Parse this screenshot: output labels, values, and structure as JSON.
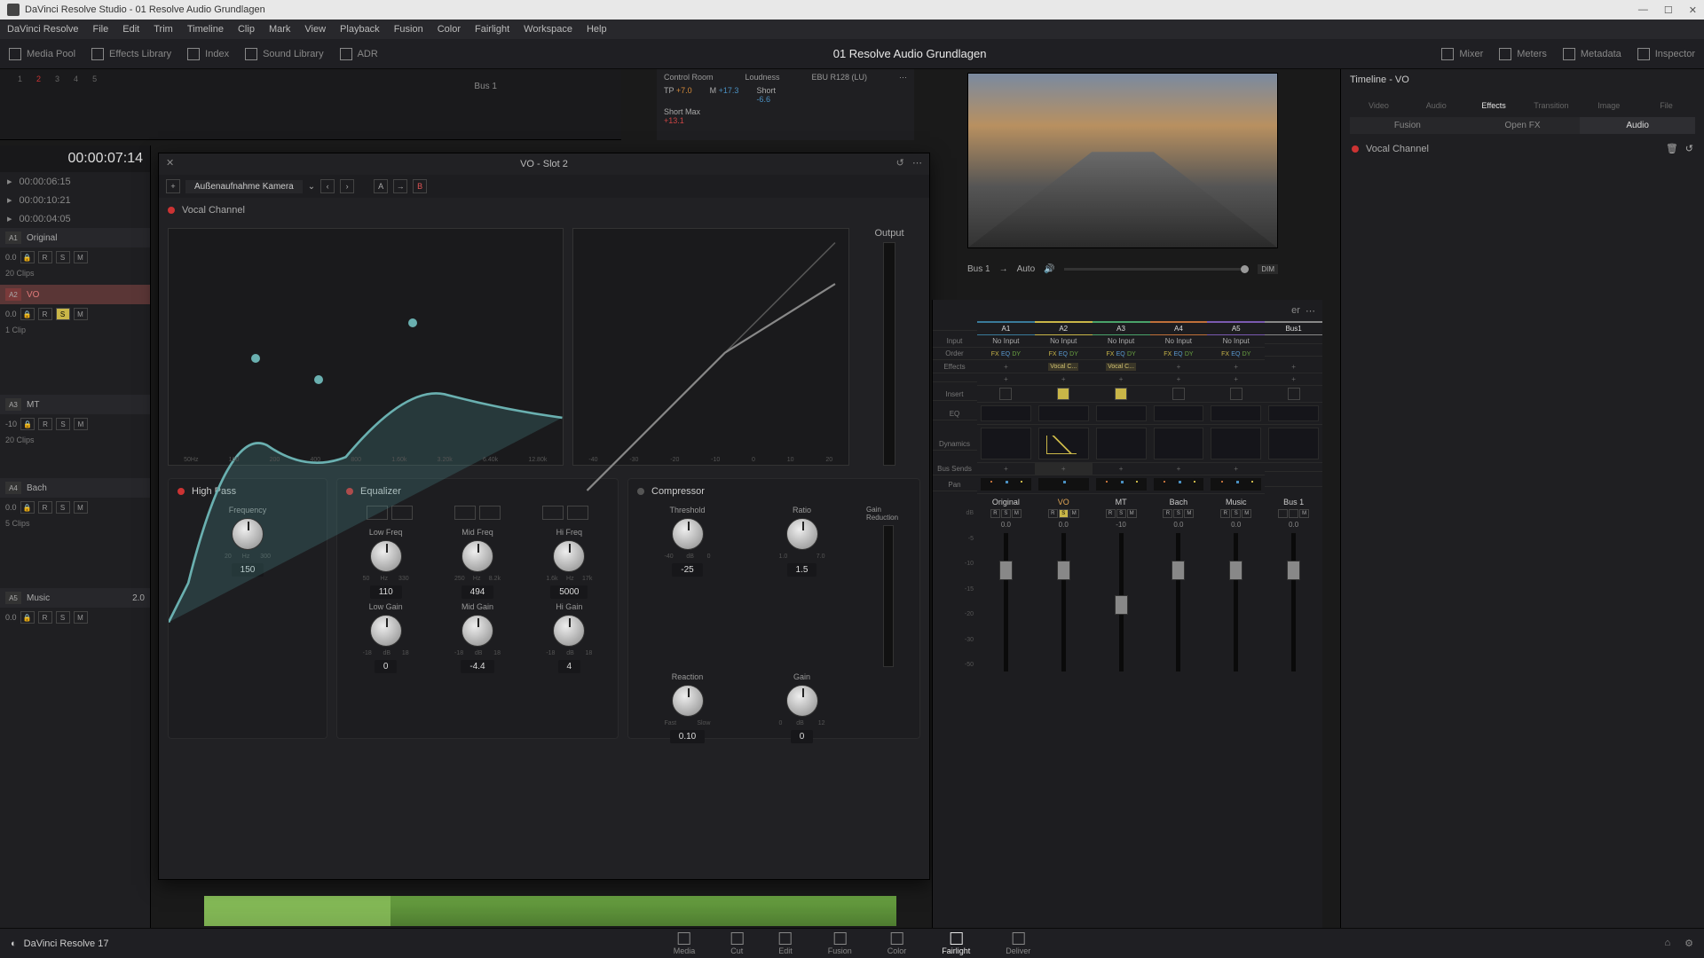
{
  "window_title": "DaVinci Resolve Studio - 01 Resolve Audio Grundlagen",
  "menubar": [
    "DaVinci Resolve",
    "File",
    "Edit",
    "Trim",
    "Timeline",
    "Clip",
    "Mark",
    "View",
    "Playback",
    "Fusion",
    "Color",
    "Fairlight",
    "Workspace",
    "Help"
  ],
  "toolbar": {
    "left": [
      "Media Pool",
      "Effects Library",
      "Index",
      "Sound Library",
      "ADR"
    ],
    "project": "01 Resolve Audio Grundlagen",
    "right": [
      "Mixer",
      "Meters",
      "Metadata",
      "Inspector"
    ]
  },
  "meters_nums": [
    "1",
    "2",
    "3",
    "4",
    "5"
  ],
  "bus_label": "Bus 1",
  "control_room": "Control Room",
  "loudness": {
    "title": "Loudness",
    "std": "EBU R128 (LU)",
    "tp_label": "TP",
    "tp_val": "+7.0",
    "m_label": "M",
    "m_val": "+17.3",
    "short_label": "Short",
    "short_val": "-6.6",
    "shortmax_label": "Short Max",
    "shortmax_val": "+13.1"
  },
  "transport": {
    "timecode": "00:00:07:14",
    "in": "00:00:06:15",
    "out": "00:00:10:21",
    "dur": "00:00:04:05"
  },
  "tracks": [
    {
      "id": "A1",
      "name": "Original",
      "vol": "0.0",
      "clips": "20 Clips"
    },
    {
      "id": "A2",
      "name": "VO",
      "vol": "0.0",
      "clips": "1 Clip",
      "sel": true,
      "solo": true
    },
    {
      "id": "A3",
      "name": "MT",
      "vol": "-10",
      "clips": "20 Clips"
    },
    {
      "id": "A4",
      "name": "Bach",
      "vol": "0.0",
      "clips": "5 Clips"
    },
    {
      "id": "A5",
      "name": "Music",
      "vol": "0.0",
      "right": "2.0"
    }
  ],
  "below_video": {
    "bus": "Bus 1",
    "auto": "Auto",
    "dim": "DIM"
  },
  "inspector": {
    "title": "Timeline - VO",
    "tabs": [
      "Video",
      "Audio",
      "Effects",
      "Transition",
      "Image",
      "File"
    ],
    "active_tab": "Effects",
    "subtabs": [
      "Fusion",
      "Open FX",
      "Audio"
    ],
    "active_sub": "Audio",
    "plugin": "Vocal Channel"
  },
  "plugin": {
    "title": "VO - Slot 2",
    "preset": "Außenaufnahme Kamera",
    "section": "Vocal Channel",
    "output": "Output",
    "eq_axis": [
      "50Hz",
      "100",
      "200",
      "400",
      "800",
      "1.60k",
      "3.20k",
      "6.40k",
      "12.80k"
    ],
    "comp_axis": [
      "-40",
      "-30",
      "-20",
      "-10",
      "0",
      "10",
      "20"
    ],
    "hp": {
      "title": "High Pass",
      "freq_label": "Frequency",
      "min": "20",
      "mid": "Hz",
      "max": "300",
      "val": "150"
    },
    "eq": {
      "title": "Equalizer",
      "cols": [
        "Low Freq",
        "Mid Freq",
        "Hi Freq"
      ],
      "freq_scales": [
        [
          "50",
          "Hz",
          "330"
        ],
        [
          "250",
          "Hz",
          "8.2k"
        ],
        [
          "1.6k",
          "Hz",
          "17k"
        ]
      ],
      "freq_vals": [
        "110",
        "494",
        "5000"
      ],
      "gain_labels": [
        "Low Gain",
        "Mid Gain",
        "Hi Gain"
      ],
      "gain_scales": [
        [
          "-18",
          "dB",
          "18"
        ],
        [
          "-18",
          "dB",
          "18"
        ],
        [
          "-18",
          "dB",
          "18"
        ]
      ],
      "gain_vals": [
        "0",
        "-4.4",
        "4"
      ]
    },
    "comp": {
      "title": "Compressor",
      "thresh_label": "Threshold",
      "thresh_scale": [
        "-40",
        "dB",
        "0"
      ],
      "thresh_val": "-25",
      "ratio_label": "Ratio",
      "ratio_scale": [
        "1.0",
        "",
        "7.0"
      ],
      "ratio_val": "1.5",
      "gr_label": "Gain Reduction",
      "react_label": "Reaction",
      "react_scale": [
        "Fast",
        "",
        "Slow"
      ],
      "react_val": "0.10",
      "gain_label": "Gain",
      "gain_scale": [
        "0",
        "dB",
        "12"
      ],
      "gain_val": "0"
    }
  },
  "mixer": {
    "title": "Mixer",
    "channels": [
      "A1",
      "A2",
      "A3",
      "A4",
      "A5",
      "Bus1"
    ],
    "row_labels": {
      "input": "Input",
      "order": "Order",
      "effects": "Effects",
      "insert": "Insert",
      "eq": "EQ",
      "dyn": "Dynamics",
      "bus": "Bus Sends",
      "pan": "Pan",
      "db": "dB"
    },
    "inputs": [
      "No Input",
      "No Input",
      "No Input",
      "No Input",
      "No Input",
      ""
    ],
    "effects": [
      "",
      "Vocal C...",
      "Vocal C...",
      "",
      "",
      ""
    ],
    "names": [
      "Original",
      "VO",
      "MT",
      "Bach",
      "Music",
      "Bus 1"
    ],
    "dbs": [
      "0.0",
      "0.0",
      "-10",
      "0.0",
      "0.0",
      "0.0"
    ],
    "scale": [
      "",
      "-5",
      "-10",
      "-15",
      "-20",
      "-30",
      "-50"
    ]
  },
  "pages": [
    "Media",
    "Cut",
    "Edit",
    "Fusion",
    "Color",
    "Fairlight",
    "Deliver"
  ],
  "active_page": "Fairlight",
  "brand": "DaVinci Resolve 17"
}
